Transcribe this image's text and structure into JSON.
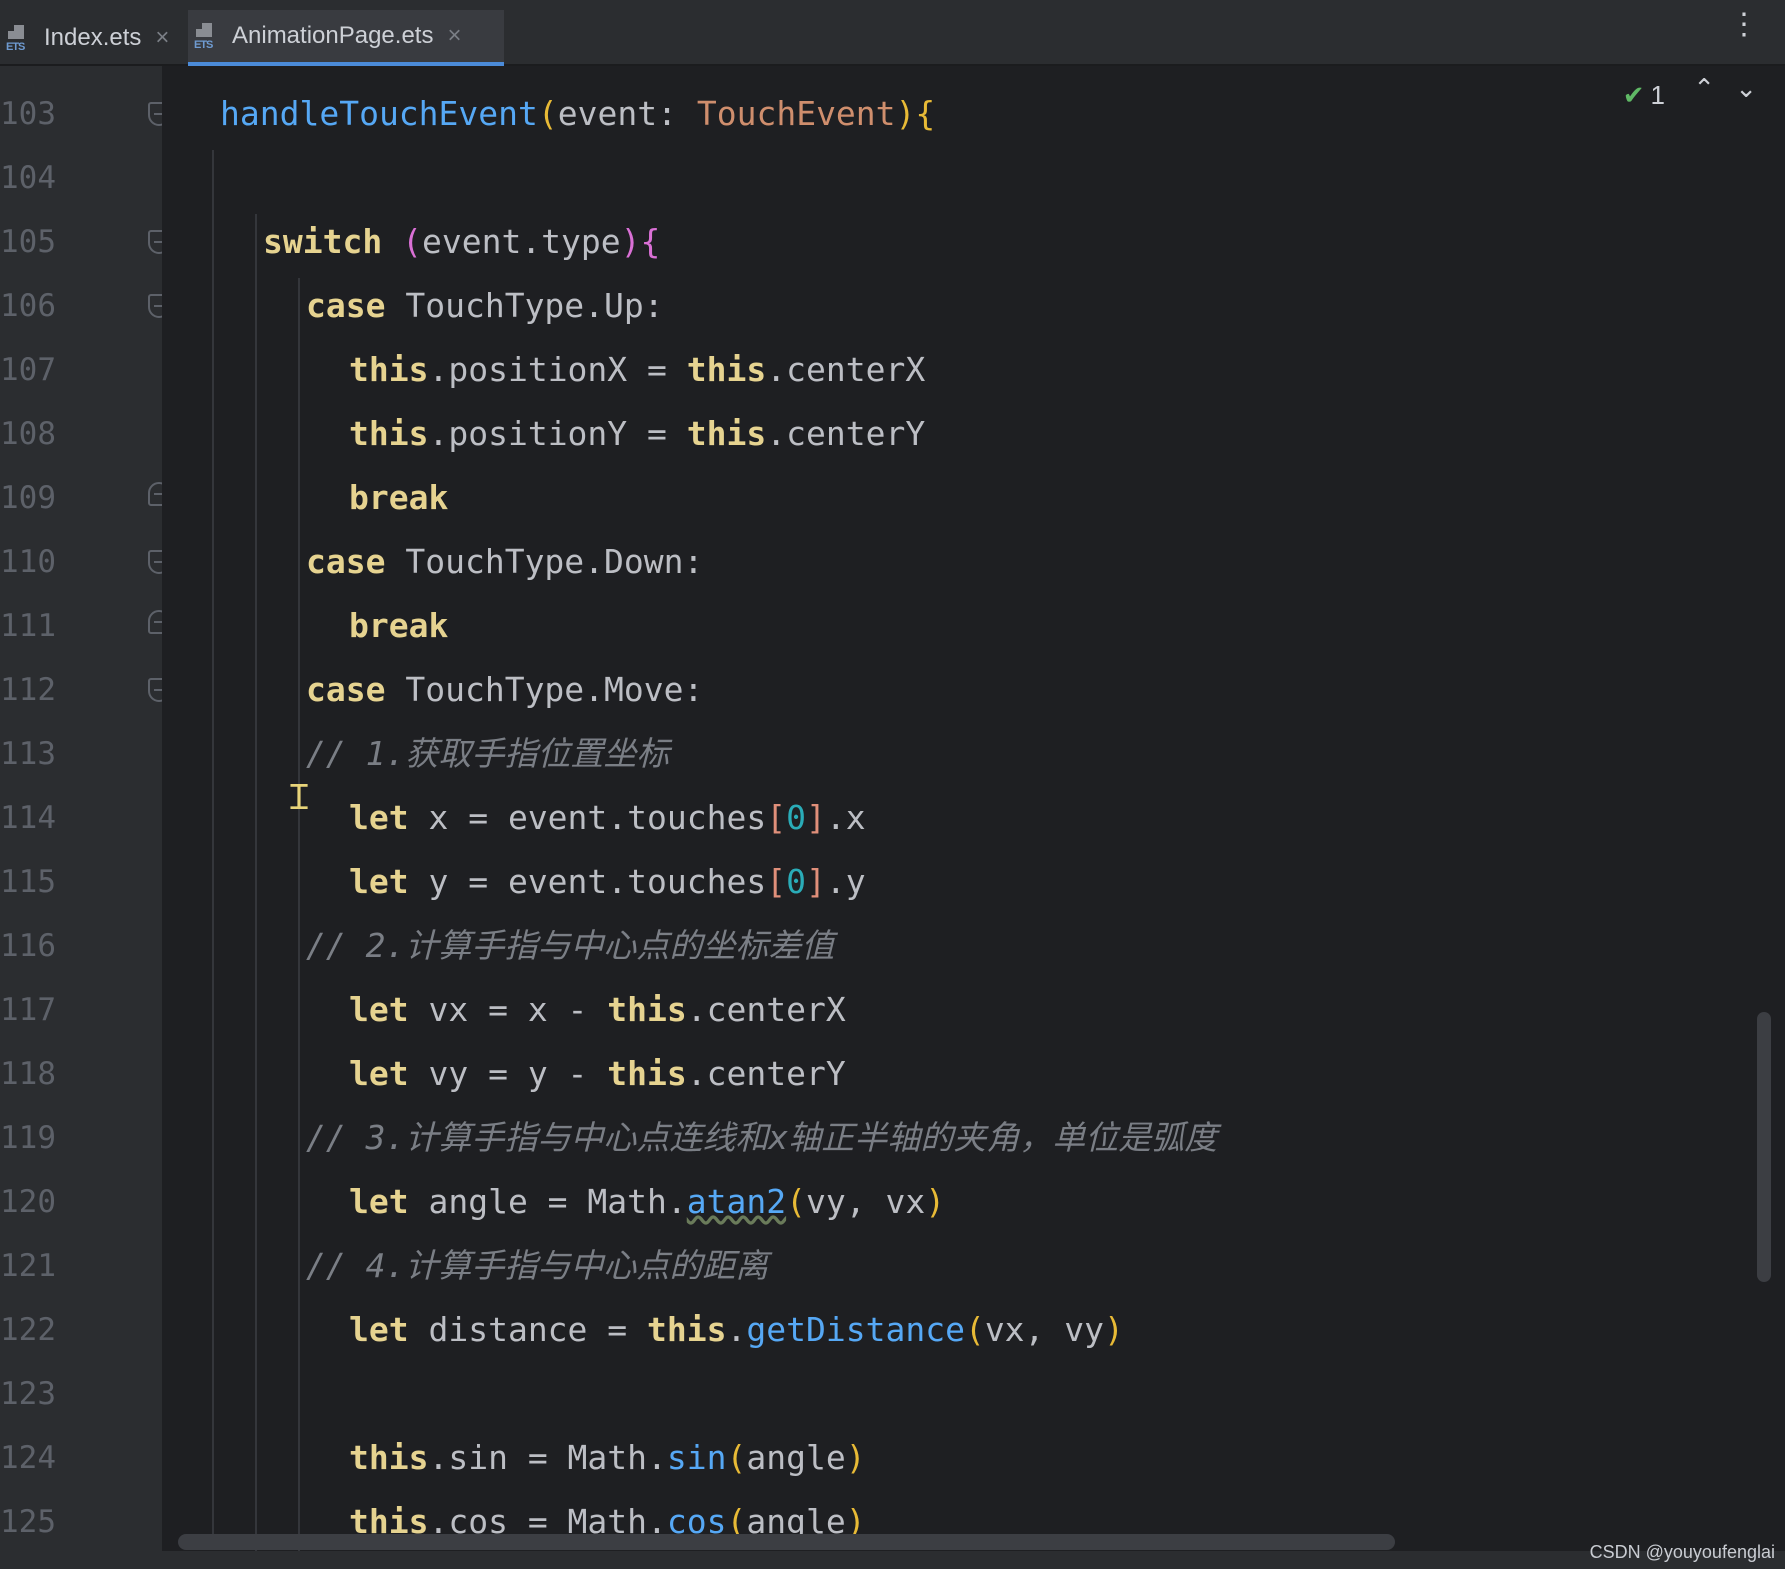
{
  "tabs": [
    {
      "label": "Index.ets",
      "active": false,
      "icon": "ets-file-icon"
    },
    {
      "label": "AnimationPage.ets",
      "active": true,
      "icon": "ets-file-icon"
    }
  ],
  "inspection": {
    "count": "1",
    "icon": "check-icon"
  },
  "line_numbers": [
    "103",
    "104",
    "105",
    "106",
    "107",
    "108",
    "109",
    "110",
    "111",
    "112",
    "113",
    "114",
    "115",
    "116",
    "117",
    "118",
    "119",
    "120",
    "121",
    "122",
    "123",
    "124",
    "125"
  ],
  "code": {
    "l103_fn": "handleTouchEvent",
    "l103_param": "event",
    "l103_type": "TouchEvent",
    "l105_kw": "switch",
    "l105_expr": "event.type",
    "l106_kw": "case",
    "l106_val": "TouchType.Up:",
    "l107_this": "this",
    "l107_a": ".positionX = ",
    "l107_this2": "this",
    "l107_b": ".centerX",
    "l108_this": "this",
    "l108_a": ".positionY = ",
    "l108_this2": "this",
    "l108_b": ".centerY",
    "l109_kw": "break",
    "l110_kw": "case",
    "l110_val": "TouchType.Down:",
    "l111_kw": "break",
    "l112_kw": "case",
    "l112_val": "TouchType.Move:",
    "l113_comment": "// 1.获取手指位置坐标",
    "l114_kw": "let",
    "l114_a": " x = event.touches",
    "l114_idx": "0",
    "l114_b": ".x",
    "l115_kw": "let",
    "l115_a": " y = event.touches",
    "l115_idx": "0",
    "l115_b": ".y",
    "l116_comment": "// 2.计算手指与中心点的坐标差值",
    "l117_kw": "let",
    "l117_a": " vx = x - ",
    "l117_this": "this",
    "l117_b": ".centerX",
    "l118_kw": "let",
    "l118_a": " vy = y - ",
    "l118_this": "this",
    "l118_b": ".centerY",
    "l119_comment": "// 3.计算手指与中心点连线和x轴正半轴的夹角，单位是弧度",
    "l120_kw": "let",
    "l120_a": " angle = Math.",
    "l120_fn": "atan2",
    "l120_args": "vy, vx",
    "l121_comment": "// 4.计算手指与中心点的距离",
    "l122_kw": "let",
    "l122_a": " distance = ",
    "l122_this": "this",
    "l122_dot": ".",
    "l122_fn": "getDistance",
    "l122_args": "vx, vy",
    "l124_this": "this",
    "l124_a": ".sin = Math.",
    "l124_fn": "sin",
    "l124_args": "angle",
    "l125_this": "this",
    "l125_a": ".cos = Math.",
    "l125_fn": "cos",
    "l125_args": "angle"
  },
  "watermark": "CSDN @youyoufenglai",
  "colors": {
    "background": "#1e1f22",
    "keyword": "#e6d390",
    "function": "#56a8f5",
    "comment": "#7a7e85",
    "accent": "#4b8bd9"
  }
}
